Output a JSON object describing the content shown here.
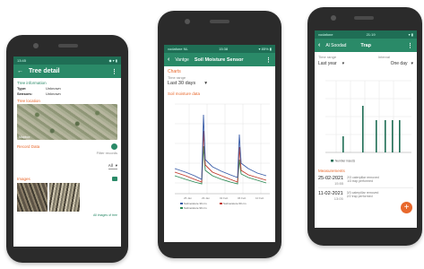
{
  "phone1": {
    "status_time": "13:45",
    "status_right": "◆ ▾ ▮",
    "title": "Tree detail",
    "section_tree_info": "Tree information",
    "rows": [
      {
        "label": "Type:",
        "value": "Unknown"
      },
      {
        "label": "Sensors:",
        "value": "Unknown"
      }
    ],
    "section_location": "Tree location",
    "map_badge": "Mapbox",
    "section_records": "Record Data",
    "filter_label": "Filter records",
    "filter_value": "All",
    "section_images": "Images",
    "all_images_link": "All images of tree"
  },
  "phone2": {
    "status_left": "vodafone NL",
    "status_time": "15:38",
    "status_right": "▾ 85% ▮",
    "back_label": "Vantge",
    "title": "Soil Moisture Sensor",
    "tab_charts": "Charts",
    "time_range_label": "Time range",
    "time_range_value": "Last 30 days",
    "chart_title": "Soil moisture data",
    "legend": [
      "Soilmoisture 30 cm",
      "Soilmoisture 60 cm",
      "Soilmoisture 90 cm"
    ],
    "colors": {
      "s30": "#3a5da8",
      "s60": "#c0392b",
      "s90": "#2e8b57"
    }
  },
  "phone3": {
    "status_left": "vodafone",
    "status_time": "21:19",
    "status_right": "▾ ▮",
    "back_label": "Al Soodad",
    "title": "Trap",
    "time_range_label": "Time range",
    "interval_label": "Interval",
    "time_range_value": "Last year",
    "interval_value": "One day",
    "legend": "Number insects",
    "section_records": "Measurements",
    "records": [
      {
        "date": "25-02-2021",
        "time": "15:55",
        "line1": "2/3 caterpillar removed",
        "line2": "1/3 trap performed"
      },
      {
        "date": "11-02-2021",
        "time": "13:05",
        "line1": "3/3 caterpillar removed",
        "line2": "2/2 trap performed"
      }
    ],
    "fab": "+"
  }
}
